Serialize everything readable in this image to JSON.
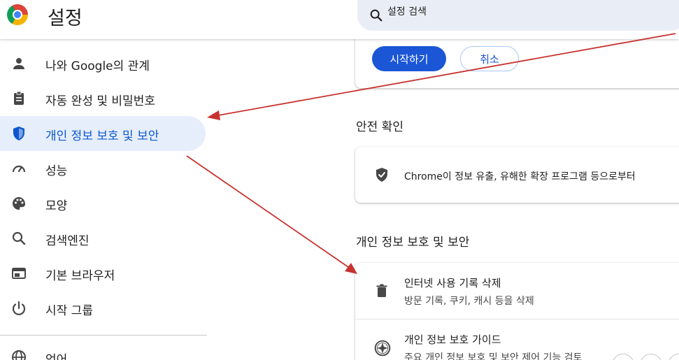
{
  "app": {
    "title": "설정",
    "logo": "chrome-logo"
  },
  "search": {
    "placeholder": "설정 검색",
    "icon": "search-icon"
  },
  "sidebar": {
    "items": [
      {
        "label": "나와 Google의 관계",
        "icon": "person-icon",
        "active": false
      },
      {
        "label": "자동 완성 및 비밀번호",
        "icon": "clipboard-icon",
        "active": false
      },
      {
        "label": "개인 정보 보호 및 보안",
        "icon": "shield-icon",
        "active": true
      },
      {
        "label": "성능",
        "icon": "speedometer-icon",
        "active": false
      },
      {
        "label": "모양",
        "icon": "palette-icon",
        "active": false
      },
      {
        "label": "검색엔진",
        "icon": "search-icon",
        "active": false
      },
      {
        "label": "기본 브라우저",
        "icon": "browser-icon",
        "active": false
      },
      {
        "label": "시작 그룹",
        "icon": "power-icon",
        "active": false
      },
      {
        "label": "언어",
        "icon": "globe-icon",
        "active": false
      }
    ]
  },
  "main": {
    "top_card": {
      "primary_label": "시작하기",
      "secondary_label": "취소"
    },
    "safety_check": {
      "title": "안전 확인",
      "text": "Chrome이 정보 유출, 유해한 확장 프로그램 등으로부터"
    },
    "privacy": {
      "title": "개인 정보 보호 및 보안",
      "rows": [
        {
          "title": "인터넷 사용 기록 삭제",
          "desc": "방문 기록, 쿠키, 캐시 등을 삭제",
          "icon": "trash-icon"
        },
        {
          "title": "개인 정보 보호 가이드",
          "desc": "주요 개인 정보 보호 및 보안 제어 기능 검토",
          "icon": "compass-icon"
        }
      ]
    }
  },
  "colors": {
    "accent": "#0b57d0",
    "active_bg": "#e6eefb",
    "annotation_arrow": "#c8322f"
  }
}
